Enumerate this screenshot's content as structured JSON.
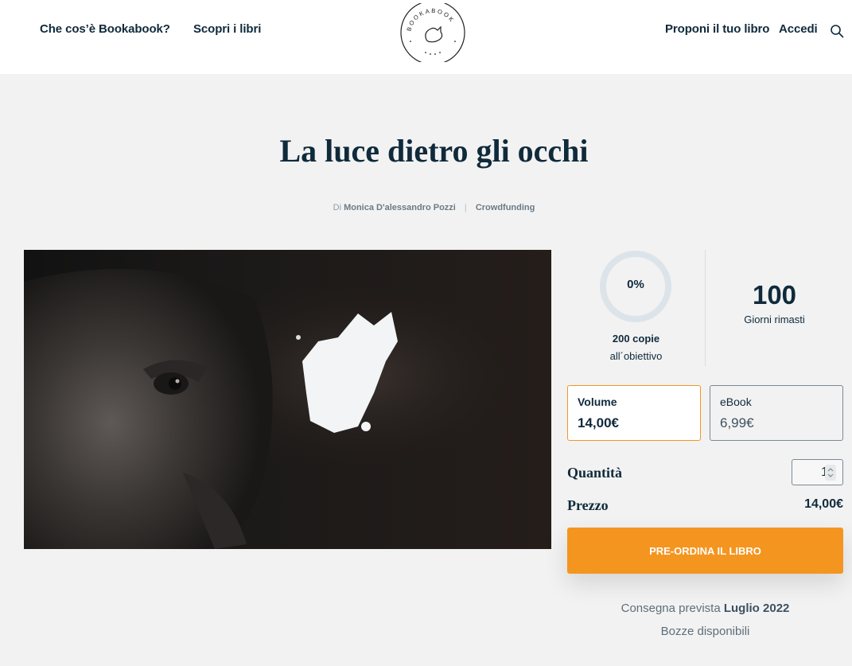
{
  "header": {
    "nav_left": [
      "Che cos’è Bookabook?",
      "Scopri i libri"
    ],
    "nav_right": [
      "Proponi il tuo libro",
      "Accedi"
    ],
    "logo_text": "BOOKABOOK"
  },
  "book": {
    "title": "La luce dietro gli occhi",
    "by_prefix": "Di",
    "author": "Monica D'alessandro Pozzi",
    "category": "Crowdfunding"
  },
  "stats": {
    "progress_percent": "0%",
    "progress_value": 0,
    "copies": "200 copie",
    "copies_label": "all´obiettivo",
    "days": "100",
    "days_label": "Giorni rimasti"
  },
  "formats": [
    {
      "name": "Volume",
      "price": "14,00€",
      "selected": true
    },
    {
      "name": "eBook",
      "price": "6,99€",
      "selected": false
    }
  ],
  "purchase": {
    "quantity_label": "Quantità",
    "quantity": "1",
    "price_label": "Prezzo",
    "price": "14,00€",
    "cta": "PRE-ORDINA IL LIBRO"
  },
  "delivery": {
    "prefix": "Consegna prevista",
    "date": "Luglio 2022",
    "drafts": "Bozze disponibili"
  },
  "colors": {
    "accent": "#f49520",
    "text": "#0f2a3b",
    "background": "#f2f2f2"
  }
}
